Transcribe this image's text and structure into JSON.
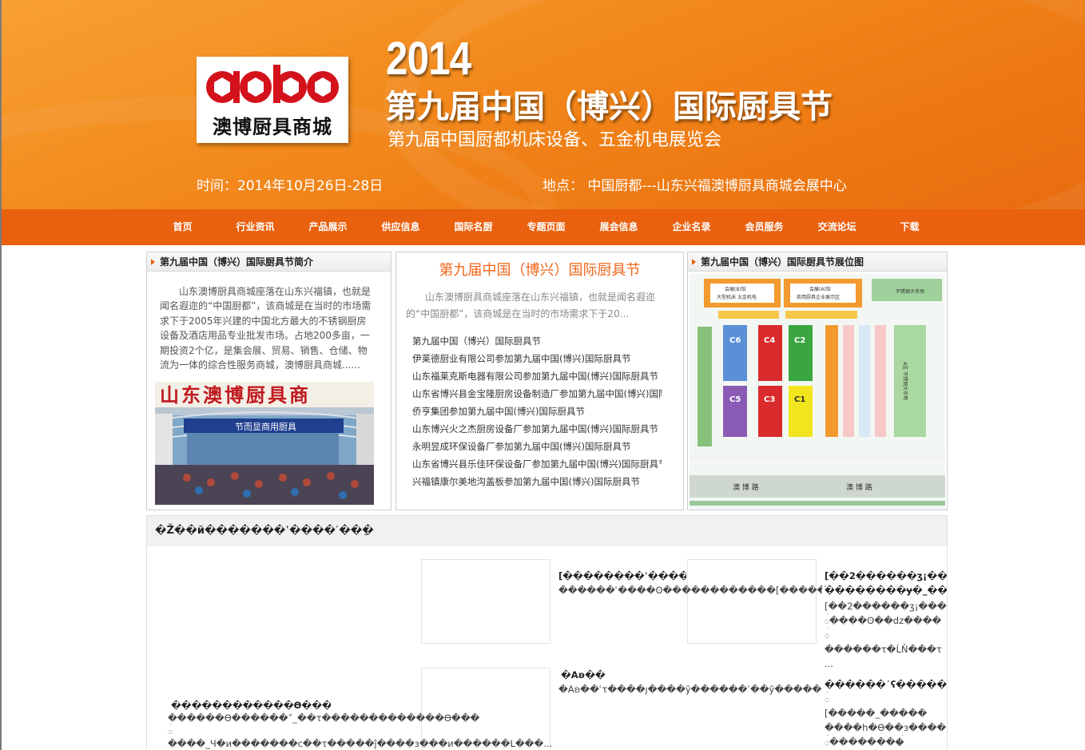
{
  "banner": {
    "logo_latin": "aobo",
    "logo_cn": "澳博厨具商城",
    "year": "2014",
    "title": "第九届中国（博兴）国际厨具节",
    "subtitle": "第九届中国厨都机床设备、五金机电展览会",
    "time": "时间：2014年10月26日-28日",
    "place": "地点： 中国厨都---山东兴福澳博厨具商城会展中心"
  },
  "nav": {
    "items": [
      {
        "label": "首页"
      },
      {
        "label": "行业资讯"
      },
      {
        "label": "产品展示"
      },
      {
        "label": "供应信息"
      },
      {
        "label": "国际名厨"
      },
      {
        "label": "专题页面"
      },
      {
        "label": "展会信息"
      },
      {
        "label": "企业名录"
      },
      {
        "label": "会员服务"
      },
      {
        "label": "交流论坛"
      },
      {
        "label": "下载"
      }
    ]
  },
  "intro_panel": {
    "heading": "第九届中国（博兴）国际厨具节简介",
    "text": "山东澳博厨具商城座落在山东兴福镇，也就是闻名遐迩的“中国厨都”，该商城是在当时的市场需求下于2005年兴建的中国北方最大的不锈钢厨房设备及酒店用品专业批发市场。占地200多亩，一期投资2个亿，是集会展、贸易、销售、仓储、物流为一体的综合性服务商城，澳博厨具商城......",
    "photo_sign": "山东澳博厨具商",
    "photo_banner": "节而显商用厨具"
  },
  "news_panel": {
    "title": "第九届中国（博兴）国际厨具节",
    "summary": "山东澳博厨具商城座落在山东兴福镇，也就是闻名遐迩的“中国厨都”，该商城是在当时的市场需求下于20...",
    "items": [
      {
        "text": "第九届中国（博兴）国际厨具节"
      },
      {
        "text": "伊莱德厨业有限公司参加第九届中国(博兴)国际厨具节"
      },
      {
        "text": "山东福莱克斯电器有限公司参加第九届中国(博兴)国际厨具节"
      },
      {
        "text": "山东省博兴县金宝隆厨房设备制造厂参加第九届中国(博兴)国际厨具节"
      },
      {
        "text": "侨亨集团参加第九届中国(博兴)国际厨具节"
      },
      {
        "text": "山东博兴火之杰厨房设备厂参加第九届中国(博兴)国际厨具节"
      },
      {
        "text": "永明昱成环保设备厂参加第九届中国(博兴)国际厨具节"
      },
      {
        "text": "山东省博兴县乐佳环保设备厂参加第九届中国(博兴)国际厨具节"
      },
      {
        "text": "兴福镇康尔美地沟盖板参加第九届中国(博兴)国际厨具节"
      }
    ]
  },
  "map_panel": {
    "heading": "第九届中国（博兴）国际厨具节展位图",
    "labels": {
      "hall_b": "会展(B)馆",
      "hall_b_sub": "大型机床 五金机电",
      "hall_a": "会展(A)馆",
      "hall_a_sub": "商用厨具企业展示区",
      "market": "不锈钢大市场",
      "c6": "C6",
      "c4": "C4",
      "c2": "C2",
      "c5": "C5",
      "c3": "C3",
      "c1": "C1",
      "a_area": "A区 不锈钢大市场",
      "road1": "澳 博 路",
      "road2": "澳 博 路"
    }
  },
  "bottom": {
    "heading": "�ּŽ��й�������ʿ����˹��ֵ�",
    "blocks": [
      {
        "title": "[��������ʿ�������̩�_",
        "line": "������ʿ����ʘ������������[��������"
      },
      {
        "title": "[��2������ʒ¡���",
        "line": "֜��������ɏ�_���"
      },
      {
        "title": "�Aʚ��",
        "line": "�Aʚ��ʿτ����ȷ����ӯ������ʿ��ӯ������"
      },
      {
        "title": "������˙ʕ������˞",
        "line": "[�����_�����"
      },
      {
        "title": "������������Ө����",
        "line": "������Ө������˅_��τ�������������Ө����"
      }
    ],
    "extra_lines": [
      "[��2������ʒ¡���",
      "꪿����ʘ��dz����",
      "꪿",
      "������τ�ĹŇ���τ",
      "...",
      "꪿",
      "����h�Ө��з����",
      "꪿��������꪿",
      "����_Ч�и�������с��τ�����ĵ����з���и������L���..."
    ]
  },
  "colors": {
    "banner_orange": "#f38d1f",
    "nav_orange": "#e9600f",
    "title_red": "#f0651a"
  }
}
